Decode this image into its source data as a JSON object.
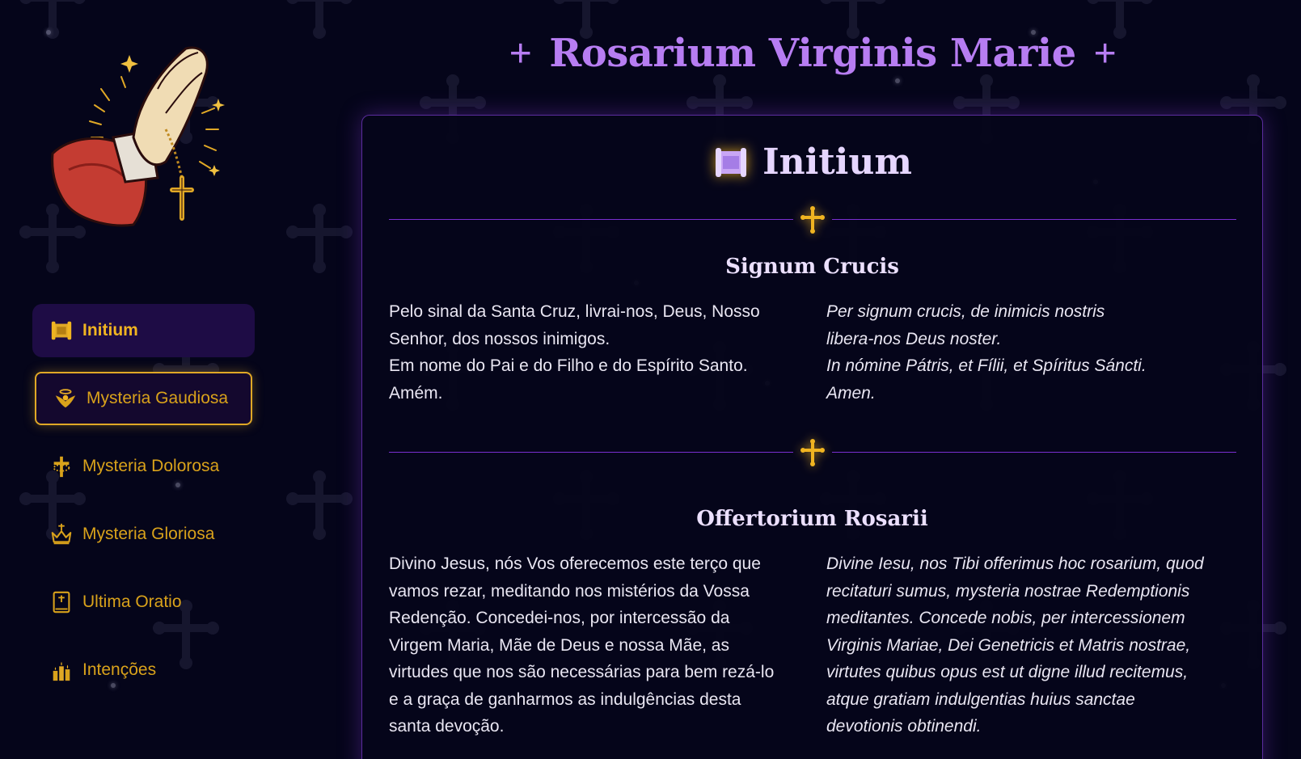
{
  "header": {
    "title": "Rosarium Virginis Marie",
    "plus_left": "+",
    "plus_right": "+"
  },
  "colors": {
    "background": "#05051a",
    "accent_purple": "#b77df2",
    "gold": "#d9a21b",
    "active_bg": "#1e0c45",
    "card_border": "#5b2c9e"
  },
  "sidebar": {
    "logo": "praying-hands-rosary-logo",
    "items": [
      {
        "label": "Initium",
        "icon": "scroll-icon",
        "state": "active"
      },
      {
        "label": "Mysteria Gaudiosa",
        "icon": "angel-icon",
        "state": "hover"
      },
      {
        "label": "Mysteria Dolorosa",
        "icon": "crucifix-crown-icon",
        "state": "normal"
      },
      {
        "label": "Mysteria Gloriosa",
        "icon": "crown-icon",
        "state": "normal"
      },
      {
        "label": "Ultima Oratio",
        "icon": "bible-icon",
        "state": "normal"
      },
      {
        "label": "Intenções",
        "icon": "candles-icon",
        "state": "normal"
      }
    ]
  },
  "main": {
    "card_title": "Initium",
    "card_icon": "scroll-icon",
    "sections": [
      {
        "title": "Signum Crucis",
        "pt": [
          "Pelo sinal da Santa Cruz, livrai-nos, Deus, Nosso",
          "Senhor, dos nossos inimigos.",
          "Em nome do Pai e do Filho e do Espírito Santo.",
          "Amém."
        ],
        "la": [
          "Per signum crucis, de inimicis nostris",
          "libera-nos Deus noster.",
          "In nómine Pátris, et Fílii, et Spíritus Sáncti.",
          "Amen."
        ]
      },
      {
        "title": "Offertorium Rosarii",
        "pt": [
          "Divino Jesus, nós Vos oferecemos este terço que",
          "vamos rezar, meditando nos mistérios da Vossa",
          "Redenção. Concedei-nos, por intercessão da",
          "Virgem Maria, Mãe de Deus e nossa Mãe, as",
          "virtudes que nos são necessárias para bem rezá-lo",
          "e a graça de ganharmos as indulgências desta",
          "santa devoção."
        ],
        "la": [
          "Divine Iesu, nos Tibi offerimus hoc rosarium, quod",
          "recitaturi sumus, mysteria nostrae Redemptionis",
          "meditantes. Concede nobis, per intercessionem",
          "Virginis Mariae, Dei Genetricis et Matris nostrae,",
          "virtutes quibus opus est ut digne illud recitemus,",
          "atque gratiam indulgentias huius sanctae",
          "devotionis obtinendi."
        ]
      }
    ]
  }
}
